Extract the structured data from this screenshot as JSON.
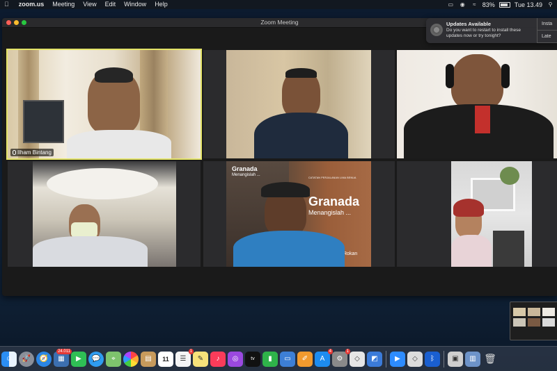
{
  "menubar": {
    "app": "zoom.us",
    "items": [
      "Meeting",
      "View",
      "Edit",
      "Window",
      "Help"
    ],
    "battery": "83%",
    "clock": "Tue 13.49"
  },
  "window": {
    "title": "Zoom Meeting"
  },
  "participants": [
    {
      "name": "Ilham Bintang",
      "active": true
    }
  ],
  "book": {
    "small_title": "Granada",
    "small_subtitle": "Menangislah ...",
    "series": "CATATAN PERJALANAN LIMA BENUA",
    "big_title": "Granada",
    "big_subtitle": "Menangislah ...",
    "author_fragment": "Rokan"
  },
  "notification": {
    "title": "Updates Available",
    "body": "Do you want to restart to install these updates now or try tonight?",
    "action1": "Insta",
    "action2": "Late"
  },
  "dock": {
    "calendar_day": "11",
    "badges": {
      "photos": "24.011",
      "reminders": "1",
      "appstore": "4",
      "settings": "1"
    }
  },
  "colors": {
    "active_speaker": "#e4e468",
    "notif_bg": "#303034",
    "dock_tint": "#3c4655"
  }
}
